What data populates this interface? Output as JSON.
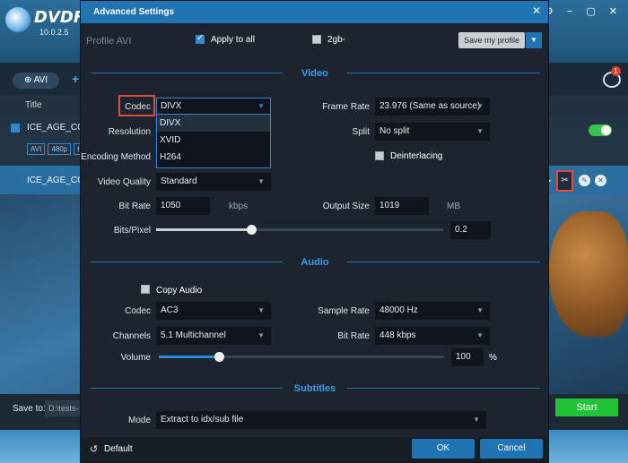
{
  "background": {
    "brand": "DVDFab",
    "version": "10.0.2.5",
    "add_button": "AVI",
    "notification_count": "1",
    "title_column": "Title",
    "row1_title": "ICE_AGE_COLL",
    "row1_tags": [
      "AVI",
      "480p",
      "H"
    ],
    "row2_title": "ICE_AGE_COLL",
    "save_to_label": "Save to:",
    "save_to_path": "D:\\tests-",
    "start_label": "Start"
  },
  "dialog": {
    "title": "Advanced Settings",
    "profile_label": "Profile AVI",
    "apply_to_all": "Apply to all",
    "apply_to_all_checked": true,
    "split_2gb": "2gb-",
    "split_2gb_checked": false,
    "save_profile": "Save my profile",
    "video": {
      "section_title": "Video",
      "codec_label": "Codec",
      "codec_value": "DIVX",
      "codec_options": [
        "DIVX",
        "XVID",
        "H264"
      ],
      "resolution_label": "Resolution",
      "encoding_method_label": "Encoding Method",
      "video_quality_label": "Video Quality",
      "video_quality_value": "Standard",
      "bit_rate_label": "Bit Rate",
      "bit_rate_value": "1050",
      "bit_rate_unit": "kbps",
      "bits_per_pixel_label": "Bits/Pixel",
      "bits_per_pixel_value": "0.2",
      "bits_per_pixel_slider": 0.33,
      "frame_rate_label": "Frame Rate",
      "frame_rate_value": "23.976 (Same as source)",
      "split_label": "Split",
      "split_value": "No split",
      "deinterlacing_label": "Deinterlacing",
      "deinterlacing_checked": false,
      "output_size_label": "Output Size",
      "output_size_value": "1019",
      "output_size_unit": "MB"
    },
    "audio": {
      "section_title": "Audio",
      "copy_audio_label": "Copy Audio",
      "copy_audio_checked": false,
      "codec_label": "Codec",
      "codec_value": "AC3",
      "channels_label": "Channels",
      "channels_value": "5.1 Multichannel",
      "volume_label": "Volume",
      "volume_value": "100",
      "volume_unit": "%",
      "volume_slider": 0.21,
      "sample_rate_label": "Sample Rate",
      "sample_rate_value": "48000 Hz",
      "bit_rate_label": "Bit Rate",
      "bit_rate_value": "448 kbps"
    },
    "subtitles": {
      "section_title": "Subtitles",
      "mode_label": "Mode",
      "mode_value": "Extract to idx/sub file"
    },
    "footer": {
      "default_label": "Default",
      "ok_label": "OK",
      "cancel_label": "Cancel"
    }
  }
}
